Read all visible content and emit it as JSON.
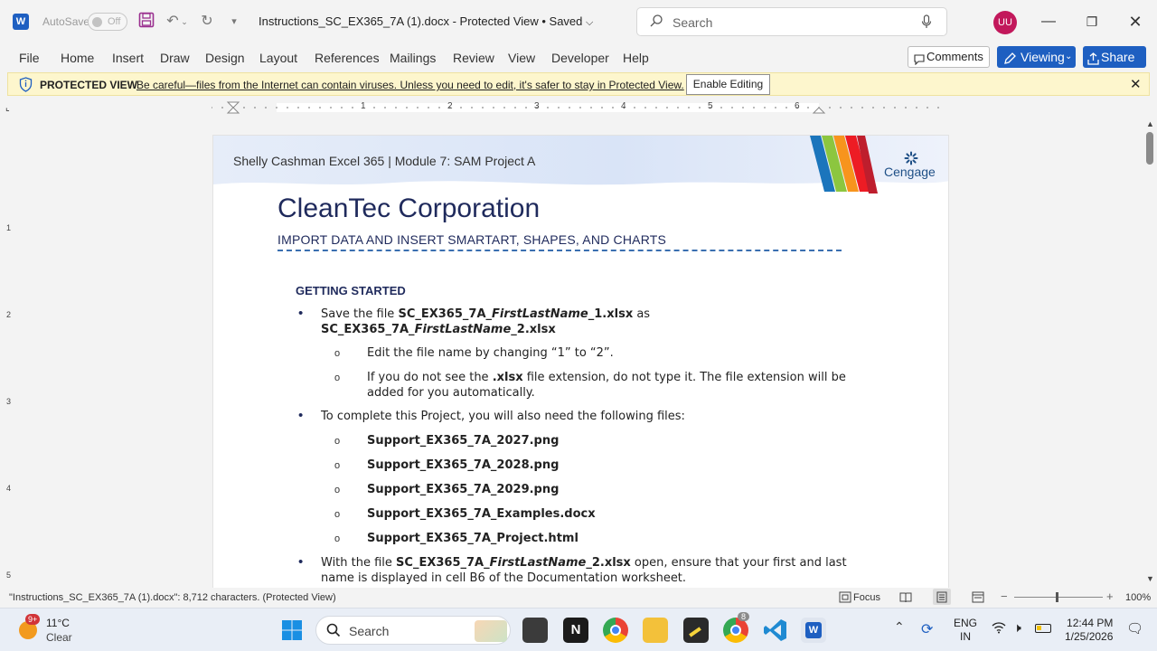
{
  "titlebar": {
    "autosave_label": "AutoSave",
    "autosave_state": "Off",
    "document_title": "Instructions_SC_EX365_7A (1).docx  -  Protected View • Saved",
    "search_placeholder": "Search",
    "user_initials": "UU"
  },
  "menu": {
    "items": [
      "File",
      "Home",
      "Insert",
      "Draw",
      "Design",
      "Layout",
      "References",
      "Mailings",
      "Review",
      "View",
      "Developer",
      "Help"
    ],
    "comments_label": "Comments",
    "viewing_label": "Viewing",
    "share_label": "Share"
  },
  "protected_view": {
    "title": "PROTECTED VIEW",
    "message": "Be careful—files from the Internet can contain viruses. Unless you need to edit, it's safer to stay in Protected View.",
    "enable_label": "Enable Editing"
  },
  "ruler": {
    "numbers": [
      "1",
      "2",
      "3",
      "4",
      "5",
      "6"
    ],
    "vnumbers": [
      "1",
      "2",
      "3",
      "4",
      "5"
    ]
  },
  "document": {
    "header_text": "Shelly Cashman Excel 365 | Module 7: SAM Project A",
    "brand": "Cengage",
    "heading": "CleanTec Corporation",
    "subheading": "IMPORT DATA AND INSERT SMARTART, SHAPES, AND CHARTS",
    "section_title": "GETTING STARTED",
    "items": {
      "b1_pre": "Save the file ",
      "b1_file_a": "SC_EX365_7A_",
      "b1_file_b": "FirstLastName",
      "b1_file_c": "_1.xlsx",
      "b1_mid": " as",
      "b1_file2_a": "SC_EX365_7A_",
      "b1_file2_b": "FirstLastName",
      "b1_file2_c": "_2.xlsx",
      "s1": "Edit the file name by changing “1” to “2”.",
      "s2_pre": "If you do not see the ",
      "s2_bold": ".xlsx",
      "s2_post": " file extension, do not type it. The file extension will be",
      "s2_line2": "added for you automatically.",
      "b2": "To complete this Project, you will also need the following files:",
      "files": [
        "Support_EX365_7A_2027.png",
        "Support_EX365_7A_2028.png",
        "Support_EX365_7A_2029.png",
        "Support_EX365_7A_Examples.docx",
        "Support_EX365_7A_Project.html"
      ],
      "b3_pre": "With the file ",
      "b3_file_a": "SC_EX365_7A_",
      "b3_file_b": "FirstLastName",
      "b3_file_c": "_2.xlsx",
      "b3_post": " open, ensure that your first and last",
      "b3_line2": "name is displayed in cell B6 of the Documentation worksheet."
    }
  },
  "statusbar": {
    "text": "\"Instructions_SC_EX365_7A (1).docx\": 8,712 characters.  (Protected View)",
    "focus_label": "Focus",
    "zoom": "100%"
  },
  "taskbar": {
    "weather_badge": "9+",
    "temperature": "11°C",
    "condition": "Clear",
    "search_placeholder": "Search",
    "chrome_badge": "8",
    "lang_line1": "ENG",
    "lang_line2": "IN",
    "time": "12:44 PM",
    "date": "1/25/2026"
  }
}
